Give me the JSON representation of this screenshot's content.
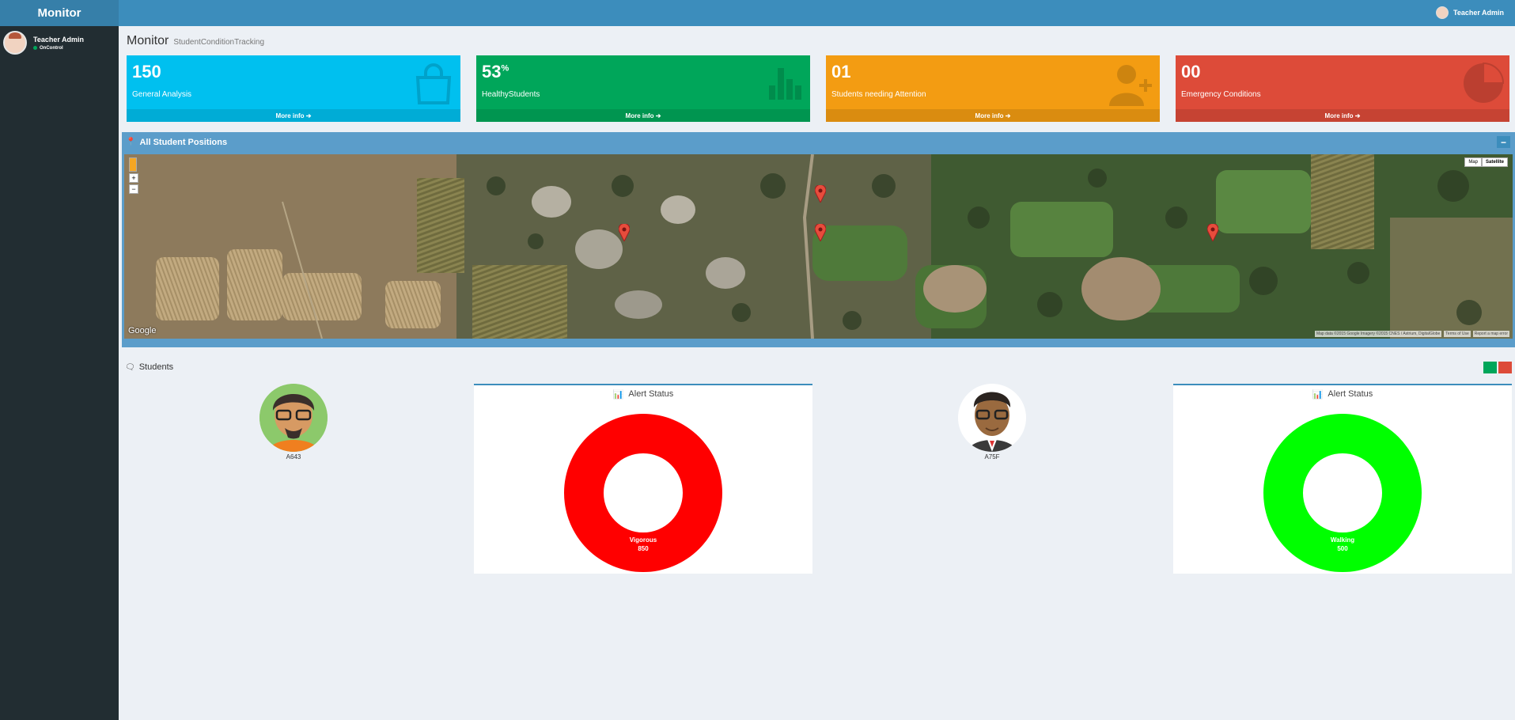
{
  "app": {
    "logo": "Monitor"
  },
  "sidebar": {
    "user_name": "Teacher Admin",
    "status": "OnControl"
  },
  "topbar": {
    "user_name": "Teacher Admin"
  },
  "page": {
    "title": "Monitor",
    "subtitle": "StudentConditionTracking"
  },
  "stats": [
    {
      "value": "150",
      "suffix": "",
      "label": "General Analysis",
      "more": "More info",
      "color": "#00c0ef",
      "icon": "bag-icon"
    },
    {
      "value": "53",
      "suffix": "%",
      "label": "HealthyStudents",
      "more": "More info",
      "color": "#00a65a",
      "icon": "bar-chart-icon"
    },
    {
      "value": "01",
      "suffix": "",
      "label": "Students needing Attention",
      "more": "More info",
      "color": "#f39c12",
      "icon": "user-add-icon"
    },
    {
      "value": "00",
      "suffix": "",
      "label": "Emergency Conditions",
      "more": "More info",
      "color": "#dd4b39",
      "icon": "pie-chart-icon"
    }
  ],
  "map": {
    "title": "All Student Positions",
    "map_btn": "Map",
    "satellite_btn": "Satellite",
    "brand": "Google",
    "copyright": "Map data ©2015 Google Imagery ©2015 CNES / Astrium, DigitalGlobe",
    "terms": "Terms of Use",
    "report": "Report a map error"
  },
  "students_section": {
    "title": "Students"
  },
  "students": [
    {
      "id": "A643",
      "chart_title": "Alert Status",
      "status": "Vigorous",
      "value": "850",
      "color": "#ff0000"
    },
    {
      "id": "A75F",
      "chart_title": "Alert Status",
      "status": "Walking",
      "value": "500",
      "color": "#00ff00"
    }
  ]
}
